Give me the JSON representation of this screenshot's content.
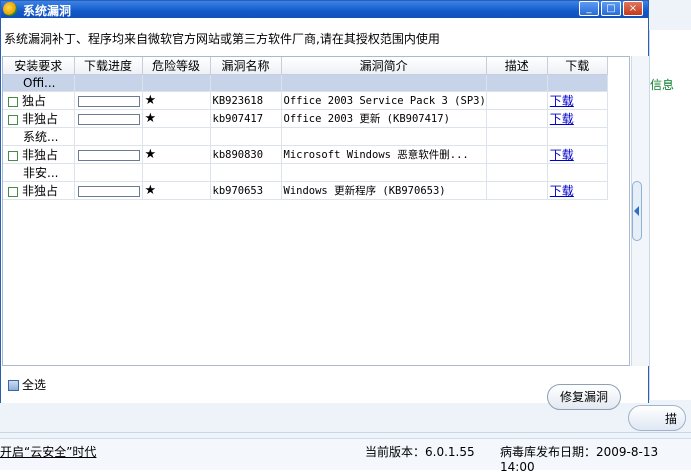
{
  "background": {
    "right_link": "信息",
    "right_button": "描",
    "status_left": "开启“云安全”时代",
    "status_version": "当前版本：6.0.1.55",
    "status_date": "病毒库发布日期：2009-8-13 14:00"
  },
  "dialog": {
    "title": "系统漏洞",
    "header_text": "系统漏洞补丁、程序均来自微软官方网站或第三方软件厂商,请在其授权范围内使用",
    "columns": [
      "安装要求",
      "下载进度",
      "危险等级",
      "漏洞名称",
      "漏洞简介",
      "描述",
      "下载"
    ],
    "rows": [
      {
        "type": "group",
        "label": "Offi...",
        "selected": true
      },
      {
        "type": "item",
        "install": "独占",
        "level": "★",
        "name": "KB923618",
        "desc": "Office 2003 Service Pack 3 (SP3)",
        "download": "下载"
      },
      {
        "type": "item",
        "install": "非独占",
        "level": "★",
        "name": "kb907417",
        "desc": "Office 2003 更新 (KB907417)",
        "download": "下载"
      },
      {
        "type": "group",
        "label": "系统...",
        "selected": false
      },
      {
        "type": "item",
        "install": "非独占",
        "level": "★",
        "name": "kb890830",
        "desc": "Microsoft Windows 恶意软件删...",
        "download": "下载"
      },
      {
        "type": "group",
        "label": "非安...",
        "selected": false
      },
      {
        "type": "item",
        "install": "非独占",
        "level": "★",
        "name": "kb970653",
        "desc": "Windows 更新程序 (KB970653)",
        "download": "下载"
      }
    ],
    "select_all": "全选",
    "repair_button": "修复漏洞"
  }
}
